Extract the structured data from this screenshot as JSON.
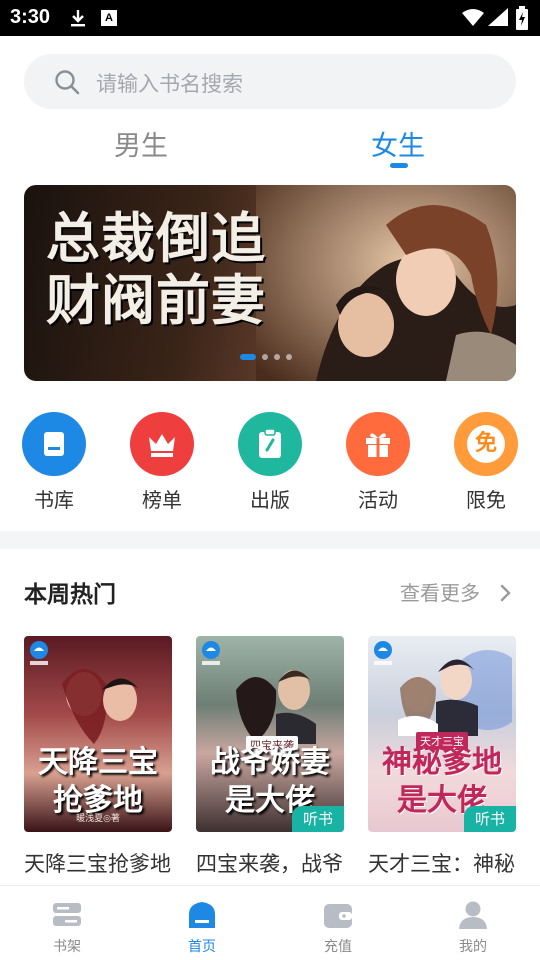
{
  "status_bar": {
    "time": "3:30",
    "notification_letter": "A"
  },
  "search": {
    "placeholder": "请输入书名搜索"
  },
  "gender_tabs": [
    {
      "label": "男生",
      "active": false
    },
    {
      "label": "女生",
      "active": true
    }
  ],
  "banner": {
    "title_line1": "总裁倒追",
    "title_line2": "财阀前妻",
    "slide_count": 4,
    "active_slide": 1
  },
  "categories": [
    {
      "label": "书库",
      "icon": "book-icon",
      "color": "#1e88e5"
    },
    {
      "label": "榜单",
      "icon": "crown-icon",
      "color": "#ef3e3e"
    },
    {
      "label": "出版",
      "icon": "clipboard-icon",
      "color": "#1fb89e"
    },
    {
      "label": "活动",
      "icon": "gift-icon",
      "color": "#ff6b3d"
    },
    {
      "label": "限免",
      "icon": "free-icon",
      "icon_text": "免",
      "color": "#ff9b3b"
    }
  ],
  "section": {
    "title": "本周热门",
    "more_label": "查看更多"
  },
  "books": [
    {
      "title": "天降三宝抢爹地",
      "cover_title": "天降三宝抢爹地",
      "cover_author": "暖浅夏◎著",
      "audio_badge": ""
    },
    {
      "title": "四宝来袭，战爷娇妻是大佬",
      "cover_title": "战爷娇妻是大佬",
      "cover_subtitle": "四宝来袭",
      "audio_badge": "听书"
    },
    {
      "title": "天才三宝：神秘爹地是大佬",
      "cover_title": "神秘爹地是大佬",
      "cover_subtitle": "天才三宝",
      "audio_badge": "听书"
    }
  ],
  "bottom_nav": [
    {
      "label": "书架",
      "icon": "bookshelf-icon",
      "active": false
    },
    {
      "label": "首页",
      "icon": "home-icon",
      "active": true
    },
    {
      "label": "充值",
      "icon": "wallet-icon",
      "active": false
    },
    {
      "label": "我的",
      "icon": "user-icon",
      "active": false
    }
  ],
  "colors": {
    "accent": "#1e88e5",
    "audio_badge": "#19b3a6"
  }
}
